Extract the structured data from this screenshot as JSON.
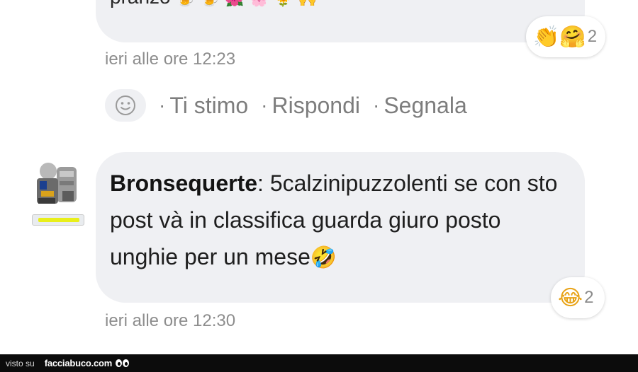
{
  "previous_comment": {
    "text_fragment": "pranzo",
    "emojis": "🍺 🍺 🌺 🌸 🌻 🙌",
    "reaction": {
      "emojis": "👏🤗",
      "count": "2"
    },
    "timestamp": "ieri alle ore 12:23"
  },
  "actions": {
    "react_icon": "smiley-icon",
    "separator": "·",
    "like": "Ti stimo",
    "reply": "Rispondi",
    "report": "Segnala"
  },
  "comment": {
    "author": "Bronsequerte",
    "author_suffix": ":",
    "text": " 5calzinipuzzolenti se con sto post và in classifica guarda giuro posto unghie per un mese",
    "trailing_emoji": "🤣",
    "reaction": {
      "emojis": "😂",
      "count": "2"
    },
    "timestamp": "ieri alle ore 12:30"
  },
  "footer": {
    "label": "visto su",
    "site": "facciabuco.com"
  },
  "colors": {
    "bubble": "#eff0f3",
    "level_bar": "#e9ef1a",
    "footer_bg": "#0c0c0c"
  }
}
